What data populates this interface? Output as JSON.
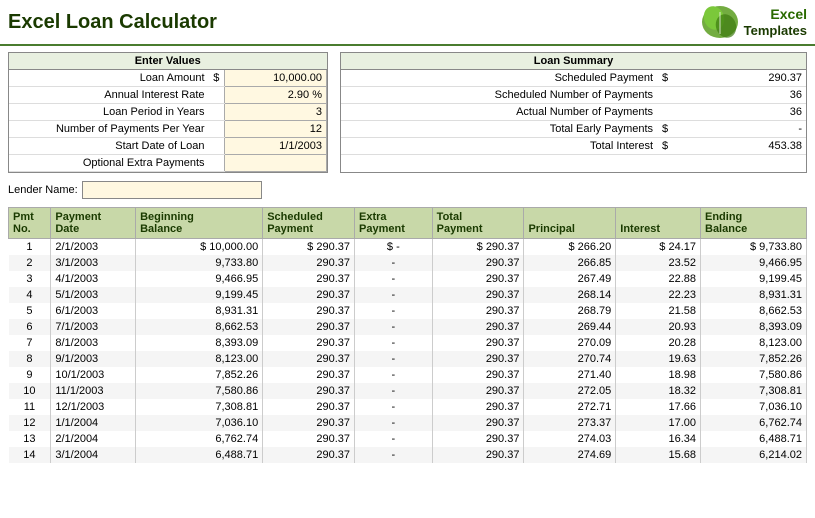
{
  "header": {
    "title": "Excel Loan Calculator",
    "logo_excel": "Excel",
    "logo_templates": "Templates"
  },
  "input_section": {
    "header": "Enter Values",
    "fields": [
      {
        "label": "Loan Amount",
        "dollar": "$",
        "value": "10,000.00"
      },
      {
        "label": "Annual Interest Rate",
        "dollar": "",
        "value": "2.90  %"
      },
      {
        "label": "Loan Period in Years",
        "dollar": "",
        "value": "3"
      },
      {
        "label": "Number of Payments Per Year",
        "dollar": "",
        "value": "12"
      },
      {
        "label": "Start Date of Loan",
        "dollar": "",
        "value": "1/1/2003"
      },
      {
        "label": "Optional Extra Payments",
        "dollar": "",
        "value": ""
      }
    ]
  },
  "summary_section": {
    "header": "Loan Summary",
    "fields": [
      {
        "label": "Scheduled Payment",
        "dollar": "$",
        "value": "290.37"
      },
      {
        "label": "Scheduled Number of Payments",
        "dollar": "",
        "value": "36"
      },
      {
        "label": "Actual Number of Payments",
        "dollar": "",
        "value": "36"
      },
      {
        "label": "Total Early Payments",
        "dollar": "$",
        "value": "-"
      },
      {
        "label": "Total Interest",
        "dollar": "$",
        "value": "453.38"
      }
    ]
  },
  "lender": {
    "label": "Lender Name:",
    "value": ""
  },
  "payment_table": {
    "columns": [
      {
        "id": "pmt_no",
        "line1": "Pmt",
        "line2": "No."
      },
      {
        "id": "payment_date",
        "line1": "Payment",
        "line2": "Date"
      },
      {
        "id": "beg_balance",
        "line1": "Beginning",
        "line2": "Balance"
      },
      {
        "id": "sched_payment",
        "line1": "Scheduled",
        "line2": "Payment"
      },
      {
        "id": "extra_payment",
        "line1": "Extra",
        "line2": "Payment"
      },
      {
        "id": "total_payment",
        "line1": "Total",
        "line2": "Payment"
      },
      {
        "id": "principal",
        "line1": "Principal",
        "line2": ""
      },
      {
        "id": "interest",
        "line1": "Interest",
        "line2": ""
      },
      {
        "id": "end_balance",
        "line1": "Ending",
        "line2": "Balance"
      }
    ],
    "rows": [
      {
        "pmt": "1",
        "date": "2/1/2003",
        "beg": "$ 10,000.00",
        "sched": "$ 290.37",
        "extra": "$ -",
        "total": "$ 290.37",
        "prin": "$ 266.20",
        "int": "$ 24.17",
        "end": "$ 9,733.80"
      },
      {
        "pmt": "2",
        "date": "3/1/2003",
        "beg": "9,733.80",
        "sched": "290.37",
        "extra": "-",
        "total": "290.37",
        "prin": "266.85",
        "int": "23.52",
        "end": "9,466.95"
      },
      {
        "pmt": "3",
        "date": "4/1/2003",
        "beg": "9,466.95",
        "sched": "290.37",
        "extra": "-",
        "total": "290.37",
        "prin": "267.49",
        "int": "22.88",
        "end": "9,199.45"
      },
      {
        "pmt": "4",
        "date": "5/1/2003",
        "beg": "9,199.45",
        "sched": "290.37",
        "extra": "-",
        "total": "290.37",
        "prin": "268.14",
        "int": "22.23",
        "end": "8,931.31"
      },
      {
        "pmt": "5",
        "date": "6/1/2003",
        "beg": "8,931.31",
        "sched": "290.37",
        "extra": "-",
        "total": "290.37",
        "prin": "268.79",
        "int": "21.58",
        "end": "8,662.53"
      },
      {
        "pmt": "6",
        "date": "7/1/2003",
        "beg": "8,662.53",
        "sched": "290.37",
        "extra": "-",
        "total": "290.37",
        "prin": "269.44",
        "int": "20.93",
        "end": "8,393.09"
      },
      {
        "pmt": "7",
        "date": "8/1/2003",
        "beg": "8,393.09",
        "sched": "290.37",
        "extra": "-",
        "total": "290.37",
        "prin": "270.09",
        "int": "20.28",
        "end": "8,123.00"
      },
      {
        "pmt": "8",
        "date": "9/1/2003",
        "beg": "8,123.00",
        "sched": "290.37",
        "extra": "-",
        "total": "290.37",
        "prin": "270.74",
        "int": "19.63",
        "end": "7,852.26"
      },
      {
        "pmt": "9",
        "date": "10/1/2003",
        "beg": "7,852.26",
        "sched": "290.37",
        "extra": "-",
        "total": "290.37",
        "prin": "271.40",
        "int": "18.98",
        "end": "7,580.86"
      },
      {
        "pmt": "10",
        "date": "11/1/2003",
        "beg": "7,580.86",
        "sched": "290.37",
        "extra": "-",
        "total": "290.37",
        "prin": "272.05",
        "int": "18.32",
        "end": "7,308.81"
      },
      {
        "pmt": "11",
        "date": "12/1/2003",
        "beg": "7,308.81",
        "sched": "290.37",
        "extra": "-",
        "total": "290.37",
        "prin": "272.71",
        "int": "17.66",
        "end": "7,036.10"
      },
      {
        "pmt": "12",
        "date": "1/1/2004",
        "beg": "7,036.10",
        "sched": "290.37",
        "extra": "-",
        "total": "290.37",
        "prin": "273.37",
        "int": "17.00",
        "end": "6,762.74"
      },
      {
        "pmt": "13",
        "date": "2/1/2004",
        "beg": "6,762.74",
        "sched": "290.37",
        "extra": "-",
        "total": "290.37",
        "prin": "274.03",
        "int": "16.34",
        "end": "6,488.71"
      },
      {
        "pmt": "14",
        "date": "3/1/2004",
        "beg": "6,488.71",
        "sched": "290.37",
        "extra": "-",
        "total": "290.37",
        "prin": "274.69",
        "int": "15.68",
        "end": "6,214.02"
      }
    ]
  }
}
